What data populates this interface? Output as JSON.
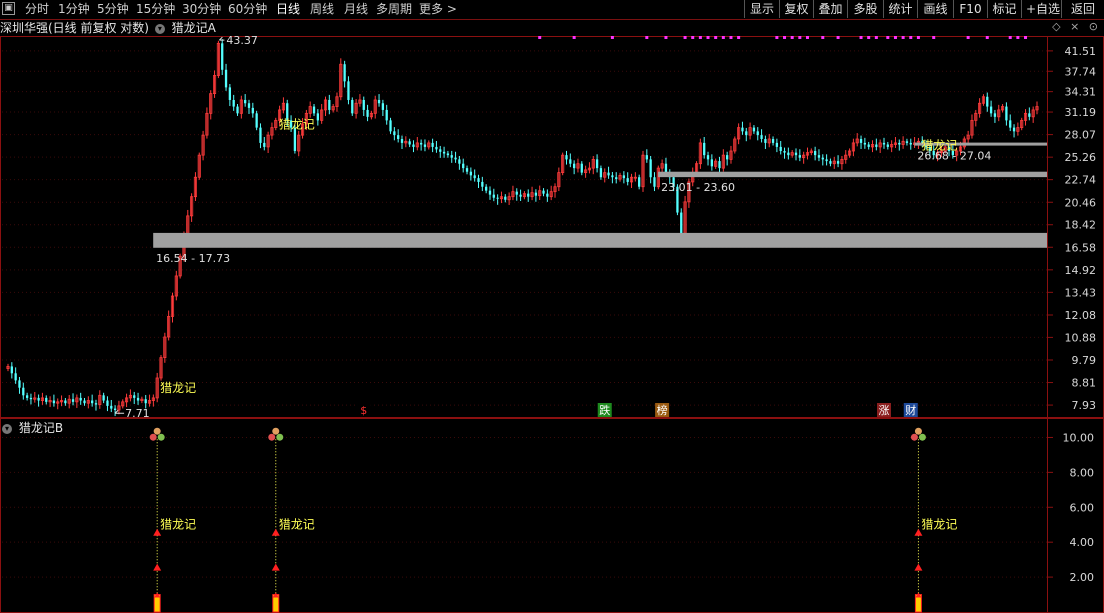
{
  "toolbar": {
    "periods": [
      {
        "label": "分时",
        "active": false
      },
      {
        "label": "1分钟",
        "active": false
      },
      {
        "label": "5分钟",
        "active": false
      },
      {
        "label": "15分钟",
        "active": false
      },
      {
        "label": "30分钟",
        "active": false
      },
      {
        "label": "60分钟",
        "active": false
      },
      {
        "label": "日线",
        "active": true
      },
      {
        "label": "周线",
        "active": false
      },
      {
        "label": "月线",
        "active": false
      },
      {
        "label": "多周期",
        "active": false
      },
      {
        "label": "更多 >",
        "active": false
      }
    ],
    "buttons": [
      "显示",
      "复权",
      "叠加",
      "多股",
      "统计",
      "画线",
      "F10",
      "标记",
      "+自选",
      "返回"
    ]
  },
  "chart": {
    "title": "深圳华强(日线 前复权 对数)",
    "indicator_a": "猎龙记A",
    "indicator_b": "猎龙记B",
    "colors": {
      "up": "#ff3b3b",
      "down": "#54ffff",
      "zone": "#a0a0a0",
      "signal": "#ffff55",
      "border": "#8b1010"
    }
  },
  "chart_data": [
    {
      "type": "candlestick",
      "yscale": "log",
      "ylim": [
        7.5,
        44.5
      ],
      "yticks": [
        "41.51",
        "37.74",
        "34.31",
        "31.19",
        "28.07",
        "25.26",
        "22.74",
        "20.46",
        "18.42",
        "16.58",
        "14.92",
        "13.43",
        "12.08",
        "10.88",
        "9.79",
        "8.81",
        "7.93"
      ],
      "high_marker": "43.37",
      "low_marker": "7.71",
      "zones": [
        {
          "label": "16.54 - 17.73",
          "low": 16.54,
          "high": 17.73
        },
        {
          "label": "23.01 - 23.60",
          "low": 23.01,
          "high": 23.6
        },
        {
          "label": "26.68 - 27.04",
          "low": 26.68,
          "high": 27.04
        }
      ],
      "signal_label": "猎龙记",
      "badges": [
        {
          "text": "$",
          "color": "#ff3030",
          "bg": "#000000"
        },
        {
          "text": "跌",
          "color": "#ffffff",
          "bg": "#1e8a1e"
        },
        {
          "text": "榜",
          "color": "#ffffff",
          "bg": "#9a5a10"
        },
        {
          "text": "涨",
          "color": "#ffffff",
          "bg": "#8a1e1e"
        },
        {
          "text": "财",
          "color": "#ffffff",
          "bg": "#1e4a9a"
        }
      ],
      "close": [
        9.5,
        9.2,
        8.9,
        8.6,
        8.3,
        8.2,
        8.15,
        8.2,
        8.1,
        8.2,
        8.05,
        8.1,
        8.0,
        8.05,
        8.1,
        8.0,
        8.15,
        8.05,
        8.2,
        8.1,
        8.0,
        8.1,
        8.0,
        7.95,
        8.3,
        8.1,
        7.9,
        7.8,
        7.75,
        7.9,
        8.05,
        8.2,
        8.3,
        8.2,
        8.1,
        8.15,
        8.0,
        8.1,
        8.2,
        9.0,
        9.9,
        10.9,
        12.0,
        13.2,
        14.5,
        15.9,
        17.5,
        19.2,
        21.0,
        23.0,
        25.5,
        28.0,
        31.0,
        34.0,
        37.0,
        43.0,
        38.0,
        35.0,
        33.0,
        32.0,
        31.0,
        33.0,
        32.5,
        31.8,
        31.0,
        29.0,
        27.0,
        26.5,
        28.0,
        29.0,
        30.0,
        31.5,
        32.5,
        30.0,
        29.0,
        26.0,
        28.0,
        29.5,
        31.0,
        32.0,
        31.0,
        30.0,
        31.5,
        33.0,
        31.5,
        32.0,
        33.5,
        39.0,
        36.0,
        33.0,
        31.0,
        32.5,
        33.0,
        31.5,
        30.5,
        31.0,
        33.0,
        32.5,
        31.5,
        30.0,
        28.5,
        28.0,
        27.5,
        27.0,
        27.2,
        26.8,
        26.5,
        27.0,
        26.8,
        26.5,
        27.0,
        26.5,
        26.2,
        25.9,
        25.7,
        25.5,
        25.2,
        25.0,
        24.5,
        24.0,
        23.6,
        23.2,
        22.9,
        22.5,
        22.0,
        21.6,
        21.2,
        20.9,
        20.8,
        21.0,
        20.7,
        21.0,
        21.5,
        21.2,
        21.0,
        21.3,
        21.0,
        21.4,
        21.1,
        21.6,
        21.3,
        21.0,
        21.5,
        22.0,
        23.5,
        25.5,
        25.0,
        24.5,
        24.0,
        24.5,
        23.5,
        23.8,
        24.0,
        25.0,
        24.0,
        23.0,
        23.5,
        23.2,
        23.0,
        22.8,
        23.2,
        22.9,
        22.5,
        23.0,
        23.0,
        22.0,
        25.5,
        25.0,
        23.0,
        22.0,
        24.0,
        24.5,
        23.5,
        23.0,
        22.0,
        19.5,
        17.7,
        20.5,
        22.5,
        23.5,
        24.5,
        27.0,
        25.5,
        25.0,
        24.2,
        24.8,
        24.0,
        25.5,
        25.0,
        26.0,
        27.5,
        29.0,
        28.5,
        28.0,
        29.0,
        28.5,
        28.0,
        27.5,
        27.0,
        27.5,
        27.0,
        26.5,
        26.0,
        25.8,
        25.5,
        25.8,
        25.5,
        25.2,
        25.5,
        25.8,
        26.0,
        25.5,
        25.2,
        25.0,
        24.8,
        24.5,
        24.8,
        24.5,
        25.0,
        25.5,
        26.0,
        27.0,
        27.5,
        27.0,
        26.8,
        26.5,
        26.8,
        26.5,
        27.0,
        26.8,
        26.5,
        26.8,
        27.0,
        26.8,
        27.2,
        27.0,
        26.8,
        27.0,
        27.2,
        27.0,
        26.5,
        26.0,
        25.5,
        25.8,
        26.0,
        26.5,
        26.0,
        25.5,
        26.0,
        26.5,
        27.5,
        28.0,
        30.0,
        31.0,
        32.5,
        33.5,
        32.0,
        31.0,
        30.5,
        31.5,
        32.0,
        30.0,
        29.0,
        28.5,
        29.0,
        30.0,
        31.0,
        30.5,
        31.5,
        32.0
      ]
    },
    {
      "type": "indicator",
      "yticks": [
        "10.00",
        "8.00",
        "6.00",
        "4.00",
        "2.00"
      ],
      "ylim": [
        0,
        11
      ],
      "signals": [
        {
          "bar": 39,
          "label": "猎龙记"
        },
        {
          "bar": 70,
          "label": "猎龙记"
        },
        {
          "bar": 238,
          "label": "猎龙记"
        }
      ]
    }
  ]
}
